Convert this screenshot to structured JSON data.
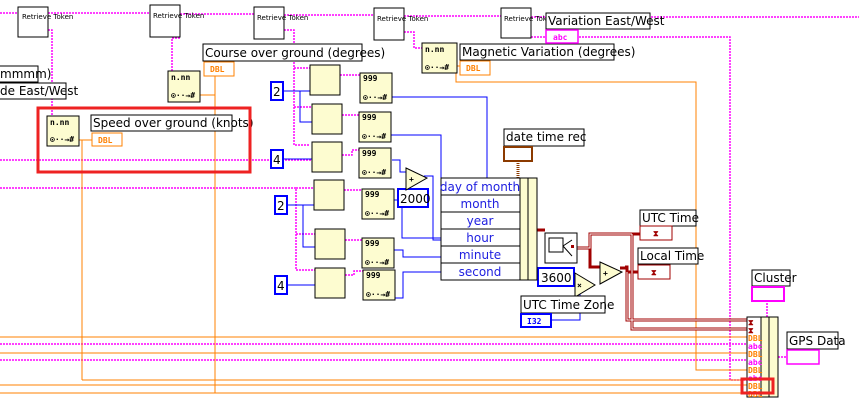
{
  "diagram": {
    "retrieve_token_label": "Retrieve Token",
    "labels": {
      "left_partial_1": "mmmm)",
      "left_partial_2": "de East/West",
      "speed": "Speed over ground (knots)",
      "course": "Course over ground (degrees)",
      "magnetic": "Magnetic Variation (degrees)",
      "variation_ew": "Variation East/West",
      "date_time_rec": "date time rec",
      "utc_time": "UTC Time",
      "local_time": "Local Time",
      "utc_time_zone": "UTC Time Zone",
      "cluster": "Cluster",
      "gps_data": "GPS Data"
    },
    "terminal_types": {
      "dbl": "DBL",
      "abc": "abc",
      "i32": "I32"
    },
    "constants": {
      "two": "2",
      "four": "4",
      "year_offset": "2000",
      "seconds_per_hour": "3600"
    },
    "bundle_fields": [
      "day of month",
      "month",
      "year",
      "hour",
      "minute",
      "second"
    ],
    "cluster_elements": [
      "time",
      "time",
      "DBL",
      "abc",
      "DBL",
      "abc",
      "DBL",
      "abc",
      "DBL",
      "DBL"
    ],
    "node_text": {
      "scan_format": "n.nn",
      "scan_num": "999",
      "plus": "+",
      "times": "×"
    },
    "colors": {
      "double_wire": "#ff8000",
      "string_wire": "#ff00ff",
      "integer_wire": "#0000ff",
      "timestamp_wire": "#a00000",
      "highlight": "#ee2222",
      "node_fill": "#fdfcd0"
    }
  }
}
